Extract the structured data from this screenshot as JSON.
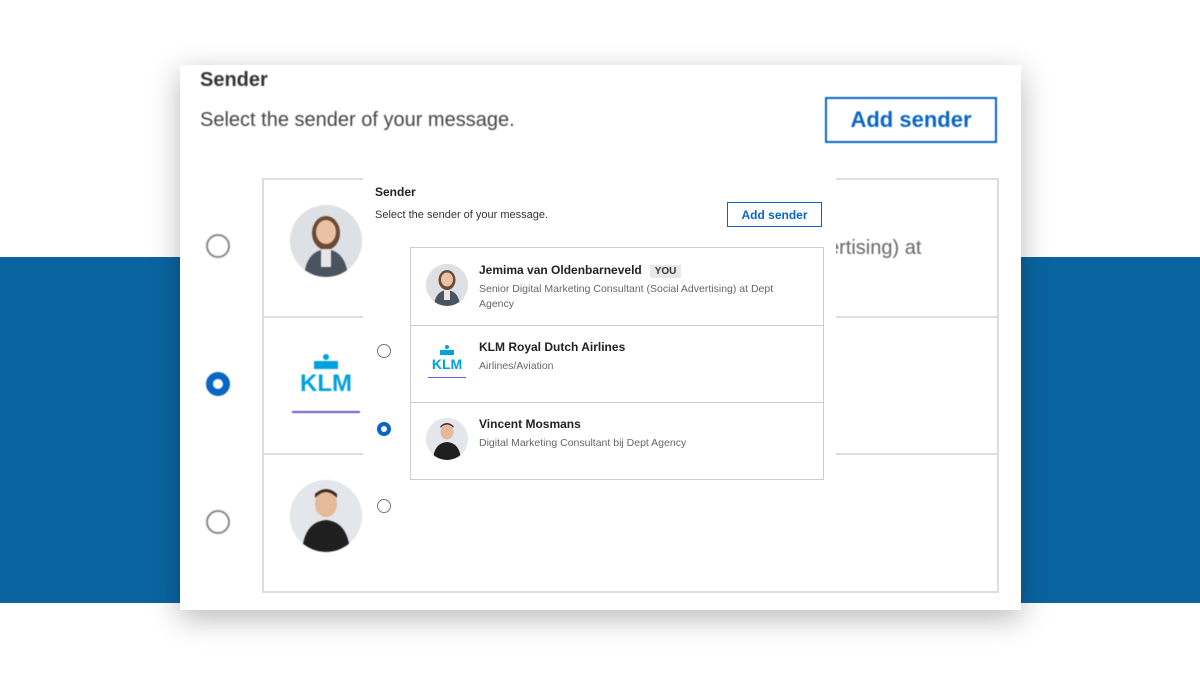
{
  "colors": {
    "band": "#0a64a0",
    "accent": "#0a66c2"
  },
  "panel": {
    "title": "Sender",
    "subtitle": "Select the sender of your message.",
    "add_label": "Add sender",
    "bg_trailing_text": "ertising) at",
    "options": [
      {
        "name": "Jemima van Oldenbarneveld",
        "badge": "YOU",
        "desc": "Senior Digital Marketing Consultant (Social Advertising) at Dept Agency",
        "avatar": "woman-avatar",
        "selected": false
      },
      {
        "name": "KLM Royal Dutch Airlines",
        "badge": "",
        "desc": "Airlines/Aviation",
        "avatar": "klm-logo",
        "logo_text": "KLM",
        "selected": true
      },
      {
        "name": "Vincent Mosmans",
        "badge": "",
        "desc": "Digital Marketing Consultant bij Dept Agency",
        "avatar": "man-avatar",
        "selected": false
      }
    ]
  }
}
